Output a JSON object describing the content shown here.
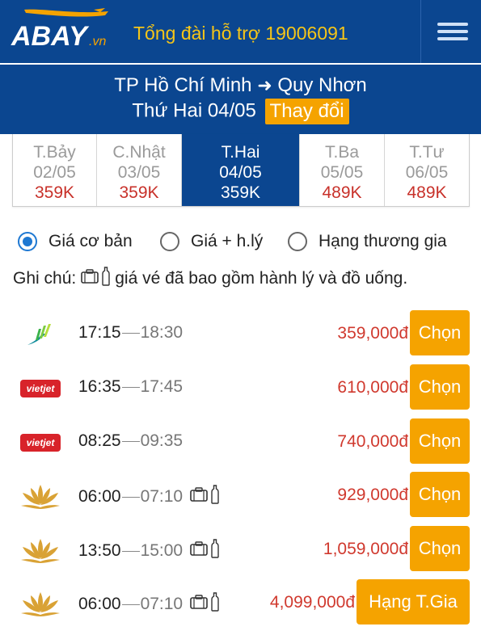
{
  "header": {
    "logo_text": "ABAY",
    "logo_suffix": ".vn",
    "hotline": "Tổng đài hỗ trợ 19006091",
    "menu_icon": "hamburger-icon"
  },
  "route": {
    "from": "TP Hồ Chí Minh",
    "to": "Quy Nhơn",
    "date": "Thứ Hai 04/05",
    "change_label": "Thay đổi"
  },
  "date_tabs": [
    {
      "day": "T.Bảy",
      "date": "02/05",
      "price": "359K"
    },
    {
      "day": "C.Nhật",
      "date": "03/05",
      "price": "359K"
    },
    {
      "day": "T.Hai",
      "date": "04/05",
      "price": "359K",
      "active": true
    },
    {
      "day": "T.Ba",
      "date": "05/05",
      "price": "489K"
    },
    {
      "day": "T.Tư",
      "date": "06/05",
      "price": "489K"
    }
  ],
  "fare_options": [
    {
      "label": "Giá cơ bản",
      "checked": true
    },
    {
      "label": "Giá + h.lý",
      "checked": false
    },
    {
      "label": "Hạng thương gia",
      "checked": false
    }
  ],
  "note": {
    "prefix": "Ghi chú:",
    "text": "giá vé đã bao gồm hành lý và đồ uống."
  },
  "flights": [
    {
      "airline": "bamboo",
      "dep": "17:15",
      "arr": "18:30",
      "price": "359,000đ",
      "button": "Chọn",
      "bag": false
    },
    {
      "airline": "vietjet",
      "dep": "16:35",
      "arr": "17:45",
      "price": "610,000đ",
      "button": "Chọn",
      "bag": false
    },
    {
      "airline": "vietjet",
      "dep": "08:25",
      "arr": "09:35",
      "price": "740,000đ",
      "button": "Chọn",
      "bag": false
    },
    {
      "airline": "vna",
      "dep": "06:00",
      "arr": "07:10",
      "price": "929,000đ",
      "button": "Chọn",
      "bag": true
    },
    {
      "airline": "vna",
      "dep": "13:50",
      "arr": "15:00",
      "price": "1,059,000đ",
      "button": "Chọn",
      "bag": true
    },
    {
      "airline": "vna",
      "dep": "06:00",
      "arr": "07:10",
      "price": "4,099,000đ",
      "button": "Hạng T.Gia",
      "bag": true
    }
  ],
  "airline_logo_text": {
    "vietjet": "vietjet"
  },
  "colors": {
    "brand": "#0b4690",
    "accent": "#f5a300",
    "price": "#d0392e",
    "hotline": "#f5c518"
  }
}
